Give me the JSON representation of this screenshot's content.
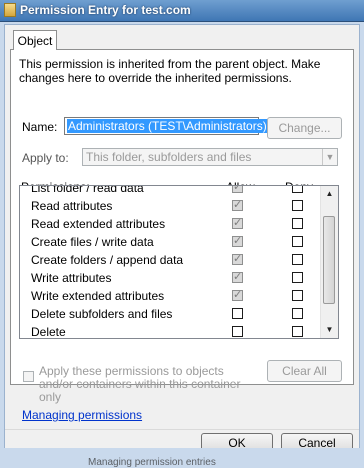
{
  "window": {
    "title": "Permission Entry for test.com"
  },
  "tabs": [
    {
      "label": "Object"
    }
  ],
  "intro_text": "This permission is inherited from the parent object. Make changes here to override the inherited permissions.",
  "name": {
    "label": "Name:",
    "value": "Administrators (TEST\\Administrators)",
    "change_button": "Change..."
  },
  "apply_to": {
    "label": "Apply to:",
    "value": "This folder, subfolders and files"
  },
  "permissions": {
    "label": "Permissions:",
    "columns": {
      "allow": "Allow",
      "deny": "Deny"
    },
    "rows": [
      {
        "label": "List folder / read data",
        "allow": true,
        "deny": false
      },
      {
        "label": "Read attributes",
        "allow": true,
        "deny": false
      },
      {
        "label": "Read extended attributes",
        "allow": true,
        "deny": false
      },
      {
        "label": "Create files / write data",
        "allow": true,
        "deny": false
      },
      {
        "label": "Create folders / append data",
        "allow": true,
        "deny": false
      },
      {
        "label": "Write attributes",
        "allow": true,
        "deny": false
      },
      {
        "label": "Write extended attributes",
        "allow": true,
        "deny": false
      },
      {
        "label": "Delete subfolders and files",
        "allow": false,
        "deny": false
      },
      {
        "label": "Delete",
        "allow": false,
        "deny": false
      }
    ]
  },
  "apply_within": {
    "label": "Apply these permissions to objects and/or containers within this container only",
    "checked": false
  },
  "clear_all_button": "Clear All",
  "managing_link": "Managing permissions",
  "ok_button": "OK",
  "cancel_button": "Cancel",
  "background_window_text": "Managing permission entries"
}
